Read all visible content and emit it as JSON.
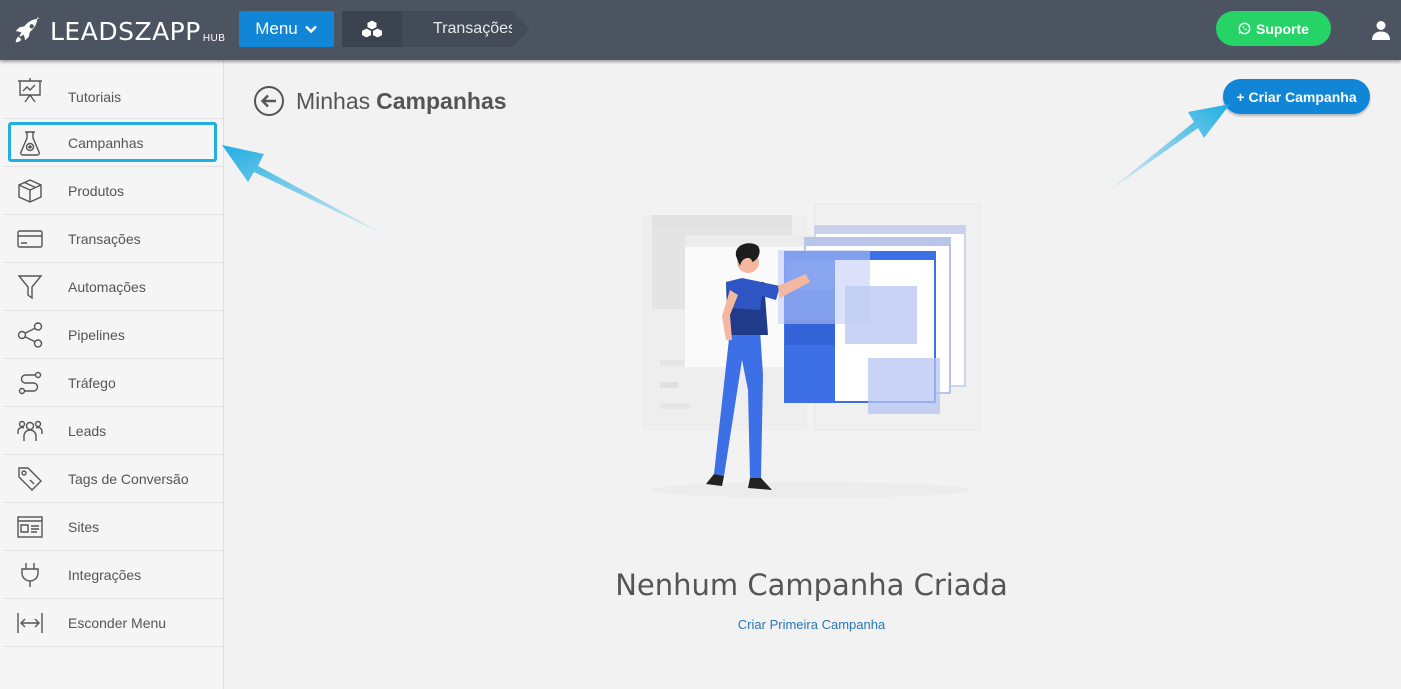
{
  "header": {
    "logo_text": "LEADSZAPP",
    "logo_sub": "HUB",
    "menu_label": "Menu",
    "breadcrumb_page": "Transações",
    "support_label": "Suporte"
  },
  "sidebar": {
    "items": [
      {
        "label": "Tutoriais",
        "icon": "presentation-board-icon"
      },
      {
        "label": "Campanhas",
        "icon": "flask-icon"
      },
      {
        "label": "Produtos",
        "icon": "box-icon"
      },
      {
        "label": "Transações",
        "icon": "credit-card-icon"
      },
      {
        "label": "Automações",
        "icon": "funnel-icon"
      },
      {
        "label": "Pipelines",
        "icon": "share-icon"
      },
      {
        "label": "Tráfego",
        "icon": "route-icon"
      },
      {
        "label": "Leads",
        "icon": "users-icon"
      },
      {
        "label": "Tags de Conversão",
        "icon": "tags-icon"
      },
      {
        "label": "Sites",
        "icon": "browser-window-icon"
      },
      {
        "label": "Integrações",
        "icon": "plug-icon"
      },
      {
        "label": "Esconder Menu",
        "icon": "collapse-arrows-icon"
      }
    ]
  },
  "main": {
    "title_light": "Minhas",
    "title_bold": "Campanhas",
    "create_button": "+ Criar Campanha",
    "empty_title": "Nenhum Campanha Criada",
    "empty_link": "Criar Primeira Campanha"
  },
  "colors": {
    "topbar": "#4c5462",
    "primary": "#1186d6",
    "whatsapp": "#25d366",
    "highlight": "#21aee2"
  }
}
